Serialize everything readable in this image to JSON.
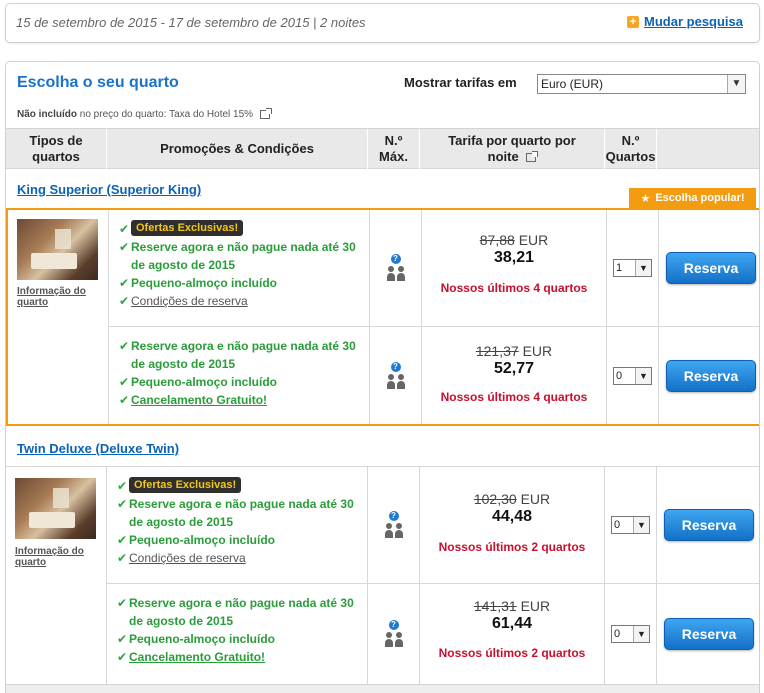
{
  "search_bar": {
    "dates": "15 de setembro de 2015 - 17 de setembro de 2015 | 2 noites",
    "change_search": "Mudar pesquisa"
  },
  "panel": {
    "title": "Escolha o seu quarto",
    "rates_label": "Mostrar tarifas em",
    "currency": "Euro (EUR)",
    "tax_not_included": "Não incluído",
    "tax_note": "no preço do quarto: Taxa do Hotel 15%"
  },
  "columns": {
    "room_types": "Tipos de quartos",
    "promotions": "Promoções & Condições",
    "max": "N.º Máx.",
    "rate": "Tarifa por quarto por noite",
    "rooms": "N.º Quartos"
  },
  "popular_badge": "Escolha popular!",
  "rooms": [
    {
      "name": "King Superior (Superior King)",
      "info_link": "Informação do quarto",
      "options": [
        {
          "badge": "Ofertas Exclusivas!",
          "line1": "Reserve agora e não pague nada até 30 de agosto de 2015",
          "line2": "Pequeno-almoço incluído",
          "line3": "Condições de reserva",
          "old_price": "87,88",
          "currency": "EUR",
          "price": "38,21",
          "scarcity": "Nossos últimos 4 quartos",
          "qty": "1",
          "button": "Reserva"
        },
        {
          "line1": "Reserve agora e não pague nada até 30 de agosto de 2015",
          "line2": "Pequeno-almoço incluído",
          "line3": "Cancelamento Gratuito!",
          "old_price": "121,37",
          "currency": "EUR",
          "price": "52,77",
          "scarcity": "Nossos últimos 4 quartos",
          "qty": "0",
          "button": "Reserva"
        }
      ]
    },
    {
      "name": "Twin Deluxe (Deluxe Twin)",
      "info_link": "Informação do quarto",
      "options": [
        {
          "badge": "Ofertas Exclusivas!",
          "line1": "Reserve agora e não pague nada até 30 de agosto de 2015",
          "line2": "Pequeno-almoço incluído",
          "line3": "Condições de reserva",
          "old_price": "102,30",
          "currency": "EUR",
          "price": "44,48",
          "scarcity": "Nossos últimos 2 quartos",
          "qty": "0",
          "button": "Reserva"
        },
        {
          "line1": "Reserve agora e não pague nada até 30 de agosto de 2015",
          "line2": "Pequeno-almoço incluído",
          "line3": "Cancelamento Gratuito!",
          "old_price": "141,31",
          "currency": "EUR",
          "price": "61,44",
          "scarcity": "Nossos últimos 2 quartos",
          "qty": "0",
          "button": "Reserva"
        }
      ]
    }
  ]
}
